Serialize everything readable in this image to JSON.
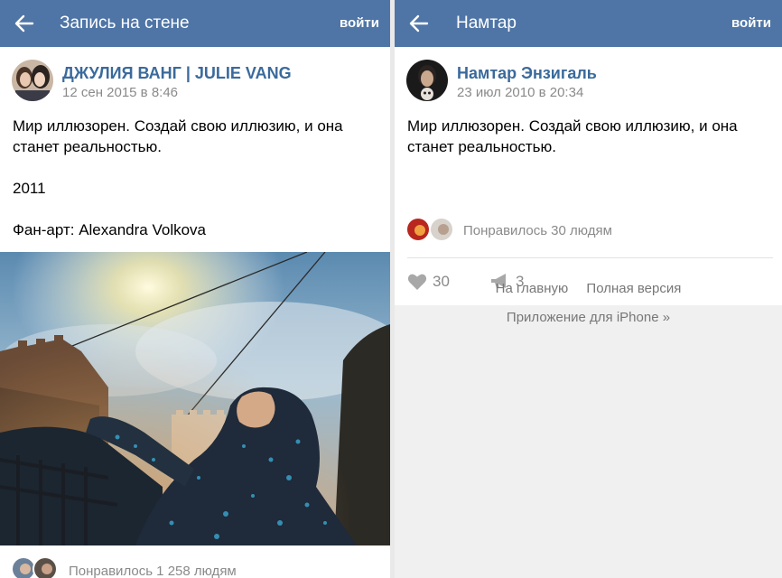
{
  "left": {
    "header": {
      "title": "Запись на стене",
      "login": "войти"
    },
    "post": {
      "author": "ДЖУЛИЯ ВАНГ | JULIE VANG",
      "date": "12 сен 2015 в 8:46",
      "text": [
        "Мир иллюзорен. Создай свою иллюзию, и она станет реальностью.",
        "2011",
        "Фан-арт: Alexandra Volkova"
      ],
      "likes": "Понравилось 1 258 людям"
    }
  },
  "right": {
    "header": {
      "title": "Намтар",
      "login": "войти"
    },
    "post": {
      "author": "Намтар Энзигаль",
      "date": "23 июл 2010 в 20:34",
      "text": "Мир иллюзорен. Создай свою иллюзию, и она станет реальностью.",
      "likes": "Понравилось 30 людям",
      "like_count": "30",
      "repost_count": "3"
    },
    "footer": {
      "home": "На главную",
      "full_version": "Полная версия",
      "app": "Приложение для iPhone »"
    }
  },
  "colors": {
    "header_bg": "#4f75a6",
    "author_link": "#3a6a9c",
    "muted_text": "#8a8a8a",
    "page_bg": "#f0f0f0"
  },
  "icons": {
    "back": "arrow-left-icon",
    "like": "heart-icon",
    "repost": "megaphone-icon"
  }
}
